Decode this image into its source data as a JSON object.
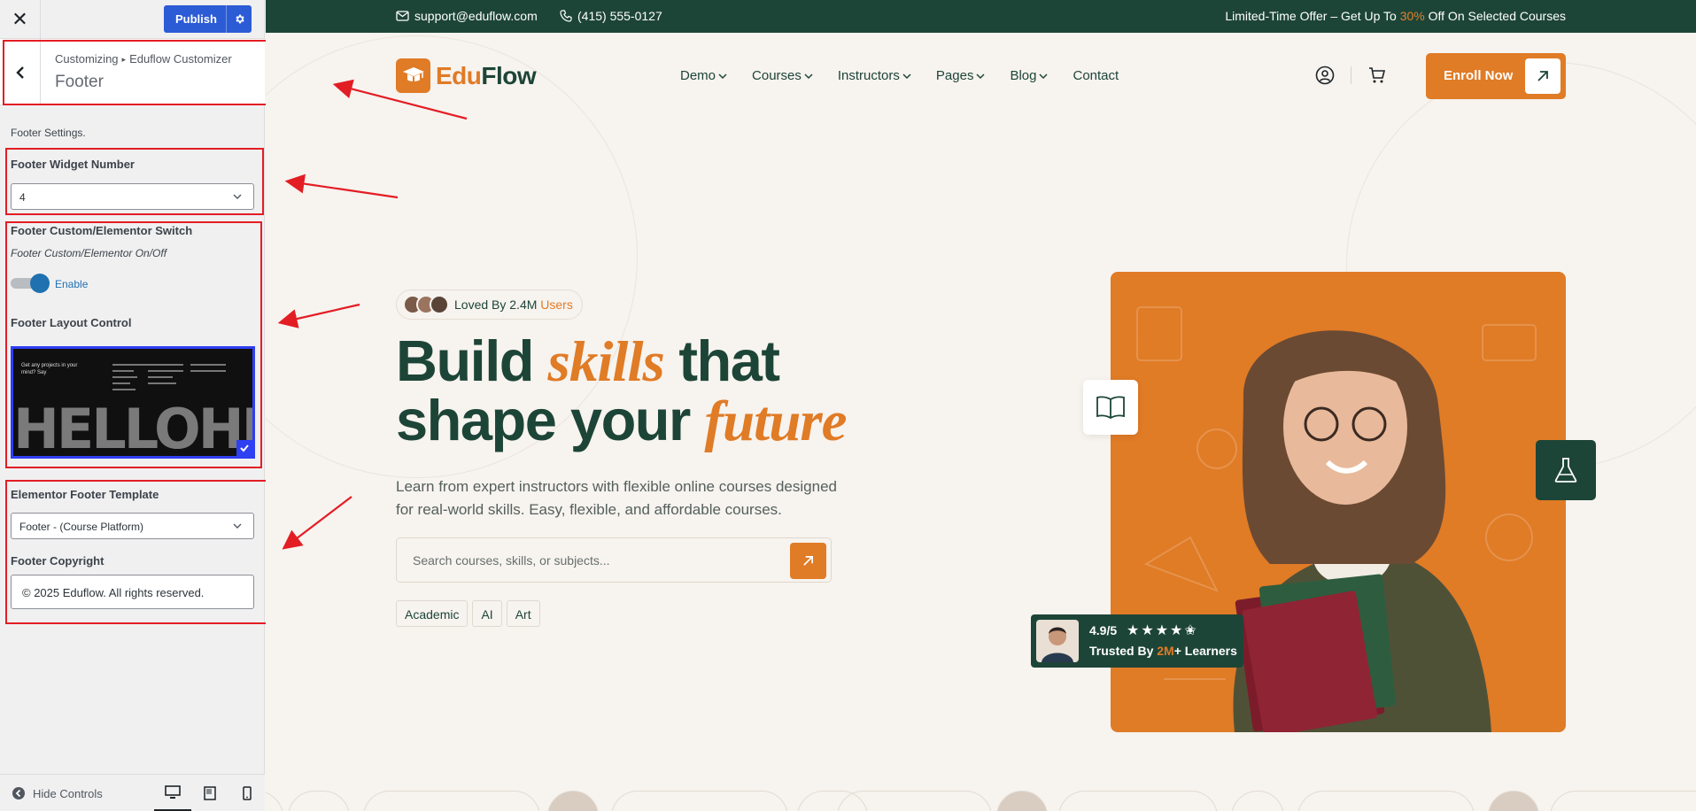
{
  "sidebar": {
    "close_icon": "close-icon",
    "publish_label": "Publish",
    "breadcrumb": [
      "Customizing",
      "Eduflow Customizer"
    ],
    "section_title": "Footer",
    "description": "Footer Settings.",
    "widget_number_label": "Footer Widget Number",
    "widget_number_value": "4",
    "switch_label": "Footer Custom/Elementor Switch",
    "switch_sub": "Footer Custom/Elementor On/Off",
    "switch_state_label": "Enable",
    "layout_label": "Footer Layout Control",
    "layout_thumb_text": "Get any projects in your mind? Say",
    "layout_thumb_word": "HELLOHELLO",
    "template_label": "Elementor Footer Template",
    "template_value": "Footer - (Course Platform)",
    "copyright_label": "Footer Copyright",
    "copyright_value": "© 2025 Eduflow. All rights reserved.",
    "hide_controls_label": "Hide Controls",
    "accent_color": "#2c5bd6",
    "highlight_color": "#e31d24"
  },
  "preview": {
    "topbar": {
      "email": "support@eduflow.com",
      "phone": "(415) 555-0127",
      "offer_pre": "Limited-Time Offer – Get Up To ",
      "offer_accent": "30%",
      "offer_post": " Off On Selected Courses"
    },
    "logo": {
      "part1": "Edu",
      "part2": "Flow"
    },
    "nav": [
      {
        "label": "Demo",
        "dropdown": true
      },
      {
        "label": "Courses",
        "dropdown": true
      },
      {
        "label": "Instructors",
        "dropdown": true
      },
      {
        "label": "Pages",
        "dropdown": true
      },
      {
        "label": "Blog",
        "dropdown": true
      },
      {
        "label": "Contact",
        "dropdown": false
      }
    ],
    "enroll_label": "Enroll Now",
    "loved": {
      "pre": "Loved By 2.4M ",
      "accent": "Users"
    },
    "hero": {
      "line1_a": "Build ",
      "line1_it": "skills",
      "line1_b": " that",
      "line2_a": "shape your ",
      "line2_it": "future",
      "description": "Learn from expert instructors with flexible online courses designed for real-world skills. Easy, flexible, and affordable courses."
    },
    "search_placeholder": "Search courses, skills, or subjects...",
    "tags": [
      "Academic",
      "AI",
      "Art"
    ],
    "rating": {
      "score": "4.9/5",
      "stars": "★★★★✬",
      "trusted_pre": "Trusted By ",
      "trusted_accent": "2M",
      "trusted_post": "+ Learners"
    },
    "brand_green": "#1d4537",
    "brand_orange": "#e07b26"
  }
}
